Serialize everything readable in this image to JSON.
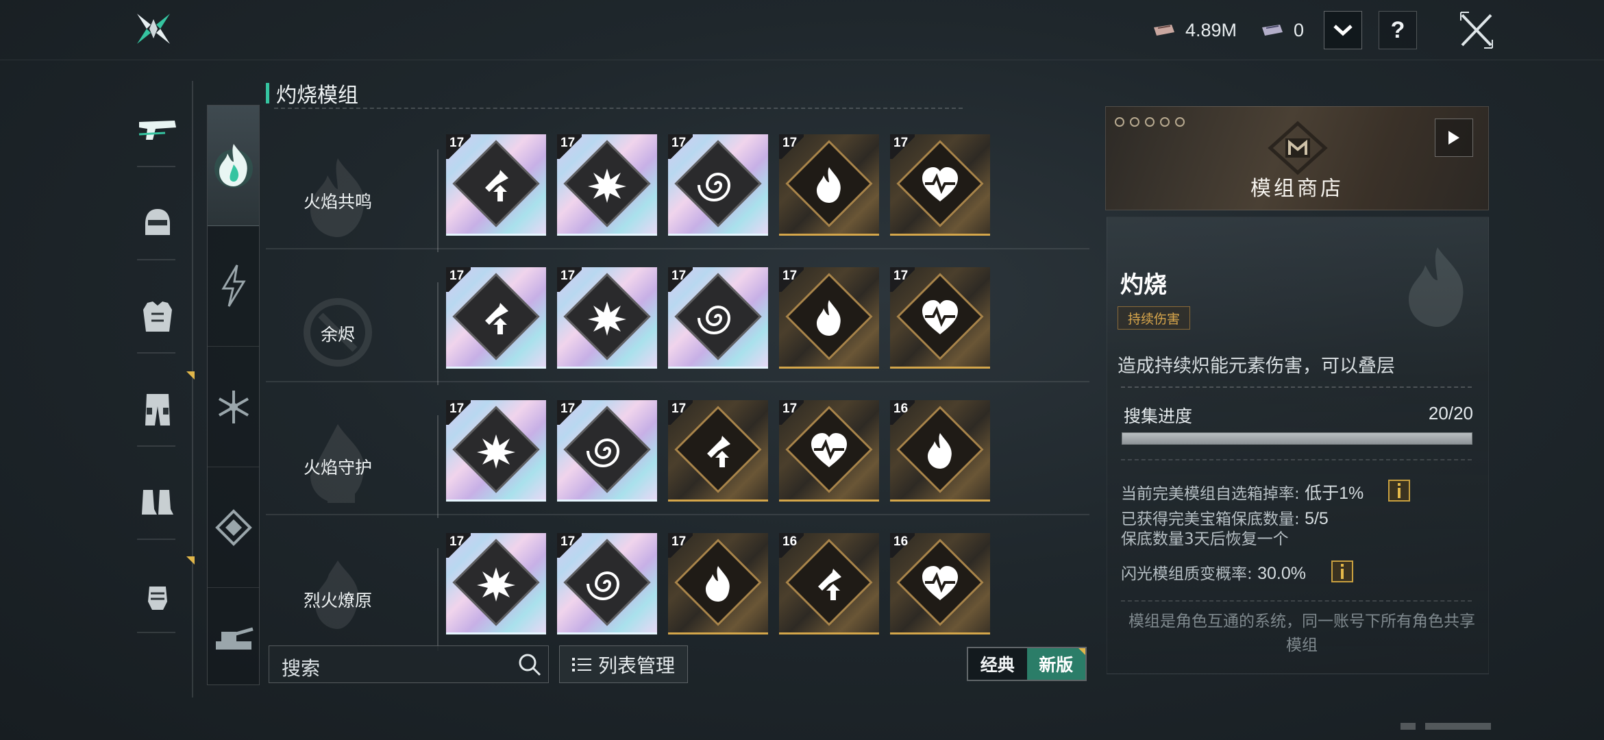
{
  "topbar": {
    "currency1_value": "4.89M",
    "currency2_value": "0",
    "help_label": "?"
  },
  "section": {
    "title": "灼烧模组"
  },
  "rows": [
    {
      "name": "火焰共鸣",
      "cards": [
        {
          "level": "17",
          "rarity": "rainbow",
          "icon": "arrow-burst-icon"
        },
        {
          "level": "17",
          "rarity": "rainbow",
          "icon": "explosion-icon"
        },
        {
          "level": "17",
          "rarity": "rainbow",
          "icon": "vortex-icon"
        },
        {
          "level": "17",
          "rarity": "gold",
          "icon": "flame-icon"
        },
        {
          "level": "17",
          "rarity": "gold",
          "icon": "heartbeat-icon"
        }
      ]
    },
    {
      "name": "余烬",
      "cards": [
        {
          "level": "17",
          "rarity": "rainbow",
          "icon": "arrow-burst-icon"
        },
        {
          "level": "17",
          "rarity": "rainbow",
          "icon": "explosion-icon"
        },
        {
          "level": "17",
          "rarity": "rainbow",
          "icon": "vortex-icon"
        },
        {
          "level": "17",
          "rarity": "gold",
          "icon": "flame-icon"
        },
        {
          "level": "17",
          "rarity": "gold",
          "icon": "heartbeat-icon"
        }
      ]
    },
    {
      "name": "火焰守护",
      "cards": [
        {
          "level": "17",
          "rarity": "rainbow",
          "icon": "explosion-icon"
        },
        {
          "level": "17",
          "rarity": "rainbow",
          "icon": "vortex-icon"
        },
        {
          "level": "17",
          "rarity": "gold",
          "icon": "arrow-burst-icon"
        },
        {
          "level": "17",
          "rarity": "gold",
          "icon": "heartbeat-icon"
        },
        {
          "level": "16",
          "rarity": "gold",
          "icon": "flame-icon"
        }
      ]
    },
    {
      "name": "烈火燎原",
      "cards": [
        {
          "level": "17",
          "rarity": "rainbow",
          "icon": "explosion-icon"
        },
        {
          "level": "17",
          "rarity": "rainbow",
          "icon": "vortex-icon"
        },
        {
          "level": "17",
          "rarity": "gold",
          "icon": "flame-icon"
        },
        {
          "level": "16",
          "rarity": "gold",
          "icon": "arrow-burst-icon"
        },
        {
          "level": "16",
          "rarity": "gold",
          "icon": "heartbeat-icon"
        }
      ]
    }
  ],
  "bottom": {
    "search_placeholder": "搜索",
    "list_manage_label": "列表管理",
    "mode_classic": "经典",
    "mode_new": "新版"
  },
  "shop": {
    "title": "模组商店"
  },
  "detail": {
    "title": "灼烧",
    "tag": "持续伤害",
    "description": "造成持续炽能元素伤害，可以叠层",
    "progress_label": "搜集进度",
    "progress_value": "20/20",
    "progress_fraction": 1.0,
    "drop_rate_label": "当前完美模组自选箱掉率: ",
    "drop_rate_value": "低于1%",
    "guarantee_label": "已获得完美宝箱保底数量: ",
    "guarantee_value": "5/5",
    "guarantee_reset": "保底数量3天后恢复一个",
    "flash_label": "闪光模组质变概率: ",
    "flash_value": "30.0%",
    "note": "模组是角色互通的系统，同一账号下所有角色共享模组"
  },
  "colors": {
    "accent_teal": "#35c4a0",
    "gold": "#d4a64a",
    "tag_orange": "#d8a64c"
  }
}
